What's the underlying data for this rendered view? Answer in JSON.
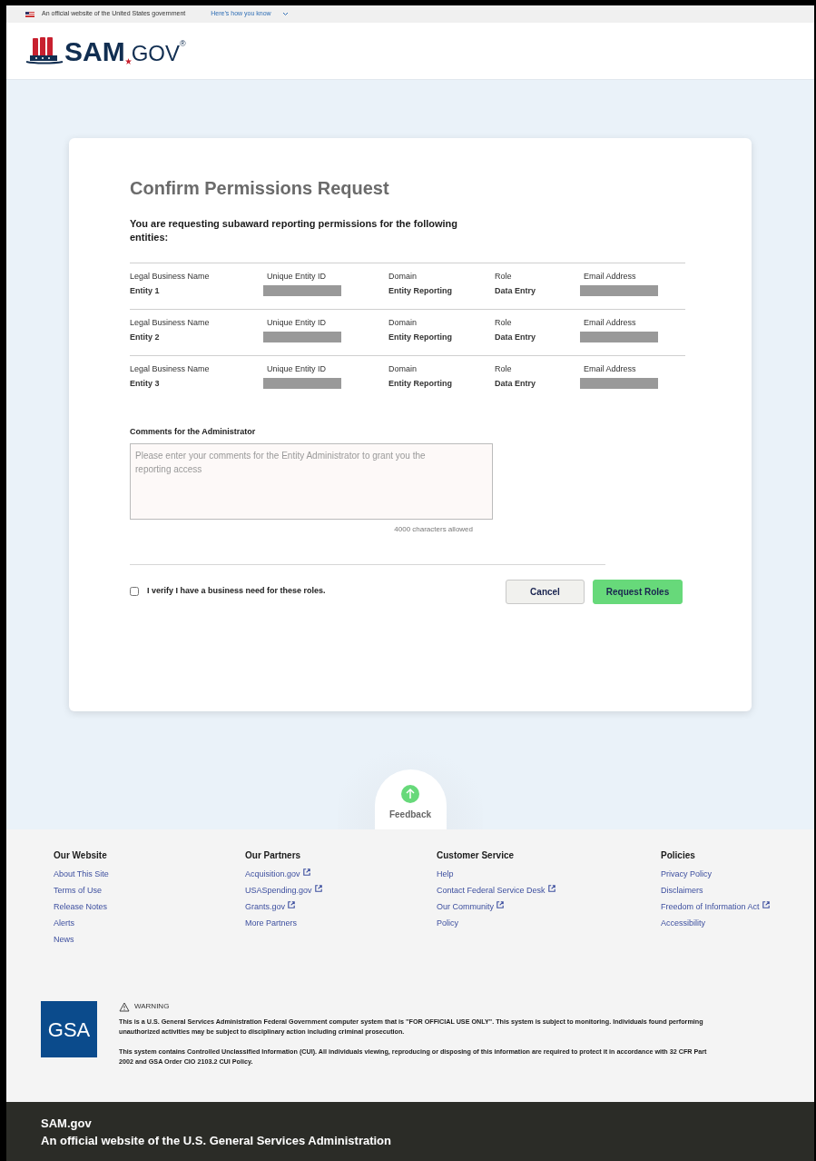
{
  "gov_banner": {
    "text": "An official website of the United States government",
    "link": "Here’s how you know"
  },
  "logo": {
    "name": "SAM",
    "suffix": "GOV",
    "mark": "®"
  },
  "card": {
    "title": "Confirm Permissions Request",
    "intro": "You are requesting subaward reporting permissions for the following entities:",
    "entities": [
      {
        "fields": [
          {
            "label": "Legal Business Name",
            "value": "Entity 1"
          },
          {
            "label": "Unique Entity ID",
            "redacted": true
          },
          {
            "label": "Domain",
            "value": "Entity Reporting"
          },
          {
            "label": "Role",
            "value": "Data Entry"
          },
          {
            "label": "Email Address",
            "redacted": true
          }
        ]
      },
      {
        "fields": [
          {
            "label": "Legal Business Name",
            "value": "Entity 2"
          },
          {
            "label": "Unique Entity ID",
            "redacted": true
          },
          {
            "label": "Domain",
            "value": "Entity Reporting"
          },
          {
            "label": "Role",
            "value": "Data Entry"
          },
          {
            "label": "Email Address",
            "redacted": true
          }
        ]
      },
      {
        "fields": [
          {
            "label": "Legal Business Name",
            "value": "Entity 3"
          },
          {
            "label": "Unique Entity ID",
            "redacted": true
          },
          {
            "label": "Domain",
            "value": "Entity Reporting"
          },
          {
            "label": "Role",
            "value": "Data Entry"
          },
          {
            "label": "Email Address",
            "redacted": true
          }
        ]
      }
    ],
    "comments": {
      "label": "Comments for the Administrator",
      "placeholder": "Please enter your comments for the Entity Administrator to grant you the reporting access",
      "hint": "4000 characters allowed"
    },
    "verify": {
      "label": "I verify I have a business need for these roles.",
      "checked": false
    },
    "buttons": [
      {
        "label": "Cancel",
        "kind": "secondary"
      },
      {
        "label": "Request Roles",
        "kind": "primary"
      }
    ]
  },
  "feedback": {
    "label": "Feedback"
  },
  "footer": {
    "columns": [
      {
        "heading": "Our Website",
        "links": [
          {
            "label": "About This Site",
            "external": false
          },
          {
            "label": "Terms of Use",
            "external": false
          },
          {
            "label": "Release Notes",
            "external": false
          },
          {
            "label": "Alerts",
            "external": false
          },
          {
            "label": "News",
            "external": false
          }
        ]
      },
      {
        "heading": "Our Partners",
        "links": [
          {
            "label": "Acquisition.gov",
            "external": true
          },
          {
            "label": "USASpending.gov",
            "external": true
          },
          {
            "label": "Grants.gov",
            "external": true
          },
          {
            "label": "More Partners",
            "external": false
          }
        ]
      },
      {
        "heading": "Customer Service",
        "links": [
          {
            "label": "Help",
            "external": false
          },
          {
            "label": "Contact Federal Service Desk",
            "external": true
          },
          {
            "label": "Our Community",
            "external": true
          },
          {
            "label": "Policy",
            "external": false
          }
        ]
      },
      {
        "heading": "Policies",
        "links": [
          {
            "label": "Privacy Policy",
            "external": false
          },
          {
            "label": "Disclaimers",
            "external": false
          },
          {
            "label": "Freedom of Information Act",
            "external": true
          },
          {
            "label": "Accessibility",
            "external": false
          }
        ]
      }
    ],
    "gsa_logo": "GSA",
    "warning": {
      "title": "WARNING",
      "paragraphs": [
        "This is a U.S. General Services Administration Federal Government computer system that is \"FOR OFFICIAL USE ONLY\". This system is subject to monitoring. Individuals found performing unauthorized activities may be subject to disciplinary action including criminal prosecution.",
        "This system contains Controlled Unclassified Information (CUI). All individuals viewing, reproducing or disposing of this information are required to protect it in accordance with 32 CFR Part 2002 and GSA Order CIO 2103.2 CUI Policy."
      ]
    }
  },
  "identifier": {
    "site": "SAM.gov",
    "tagline": "An official website of the U.S. General Services Administration"
  }
}
